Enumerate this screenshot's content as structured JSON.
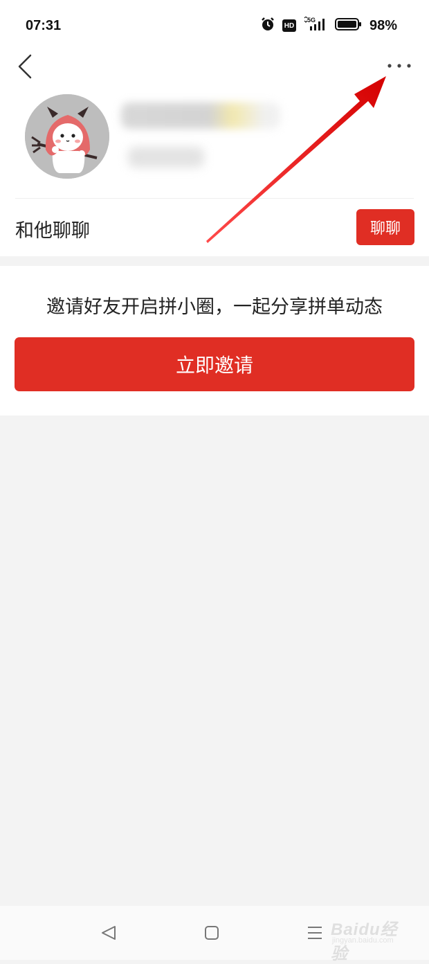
{
  "status_bar": {
    "time": "07:31",
    "hd_label": "HD",
    "network_label": "5G",
    "battery_percent": "98%",
    "icons": [
      "alarm-icon",
      "hd-icon",
      "signal-5g-icon",
      "battery-icon"
    ]
  },
  "nav": {
    "back_icon": "chevron-left-icon",
    "more_icon": "more-horizontal-icon"
  },
  "profile": {
    "avatar_icon": "devil-cartoon-avatar"
  },
  "chat_row": {
    "label": "和他聊聊",
    "button_label": "聊聊"
  },
  "invite": {
    "text": "邀请好友开启拼小圈，一起分享拼单动态",
    "button_label": "立即邀请"
  },
  "system_nav": {
    "icons": [
      "back-triangle-icon",
      "home-square-icon",
      "menu-lines-icon"
    ]
  },
  "watermark": {
    "main": "Baidu经验",
    "sub": "jingyan.baidu.com"
  },
  "colors": {
    "accent_red": "#e02e24",
    "annotation_arrow": "#e8131b",
    "background_gray": "#f3f3f3"
  }
}
